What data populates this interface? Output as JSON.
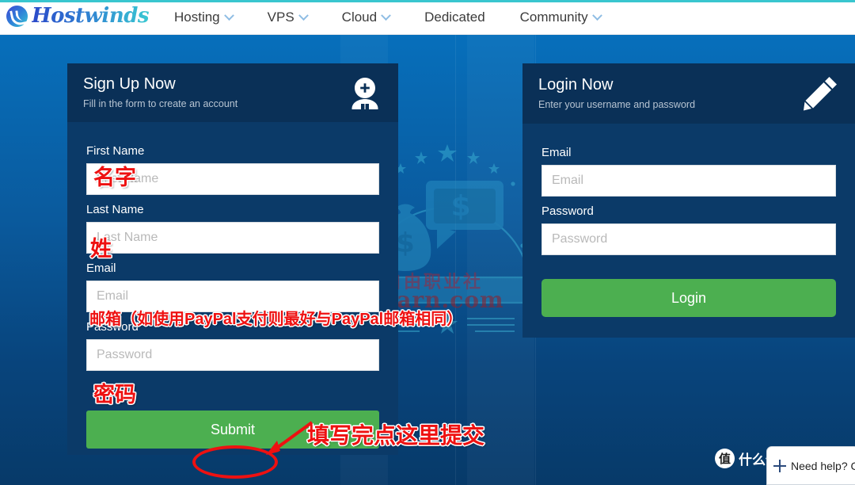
{
  "header": {
    "logo_text": "Hostwinds",
    "logo_icon": "hostwinds-wave-logo",
    "nav": [
      {
        "label": "Hosting",
        "has_caret": true
      },
      {
        "label": "VPS",
        "has_caret": true
      },
      {
        "label": "Cloud",
        "has_caret": true
      },
      {
        "label": "Dedicated",
        "has_caret": false
      },
      {
        "label": "Community",
        "has_caret": true
      }
    ]
  },
  "signup": {
    "title": "Sign Up Now",
    "subtitle": "Fill in the form to create an account",
    "icon": "add-user-icon",
    "fields": [
      {
        "label": "First Name",
        "placeholder": "First Name",
        "value": ""
      },
      {
        "label": "Last Name",
        "placeholder": "Last Name",
        "value": ""
      },
      {
        "label": "Email",
        "placeholder": "Email",
        "value": ""
      },
      {
        "label": "Password",
        "placeholder": "Password",
        "value": ""
      }
    ],
    "submit_label": "Submit"
  },
  "login": {
    "title": "Login Now",
    "subtitle": "Enter your username and password",
    "icon": "pencil-icon",
    "fields": [
      {
        "label": "Email",
        "placeholder": "Email",
        "value": ""
      },
      {
        "label": "Password",
        "placeholder": "Password",
        "value": ""
      }
    ],
    "login_label": "Login"
  },
  "annotations": [
    {
      "id": "first",
      "text": "名字"
    },
    {
      "id": "last",
      "text": "姓"
    },
    {
      "id": "email",
      "text": "邮箱（如使用PayPal支付则最好与PayPal邮箱相同）"
    },
    {
      "id": "pass",
      "text": "密码"
    },
    {
      "id": "submit",
      "text": "填写完点这里提交"
    }
  ],
  "watermark": {
    "cn": "自由职业社",
    "en": "ieearn.com",
    "emblem": "money-bag-monitor-laurel-emblem"
  },
  "overlays": {
    "smzdm_mark": "值",
    "smzdm_text": "什么值得买",
    "chat_text": "Need help? C",
    "chat_icon": "plus-icon"
  },
  "colors": {
    "page_top": "#0673c1",
    "page_bottom": "#073a69",
    "card_head": "#0a3057",
    "card_body": "#0b3a68",
    "green": "#4caf50",
    "teal_rule": "#39c6cf",
    "annotation_red": "#ee1111"
  }
}
